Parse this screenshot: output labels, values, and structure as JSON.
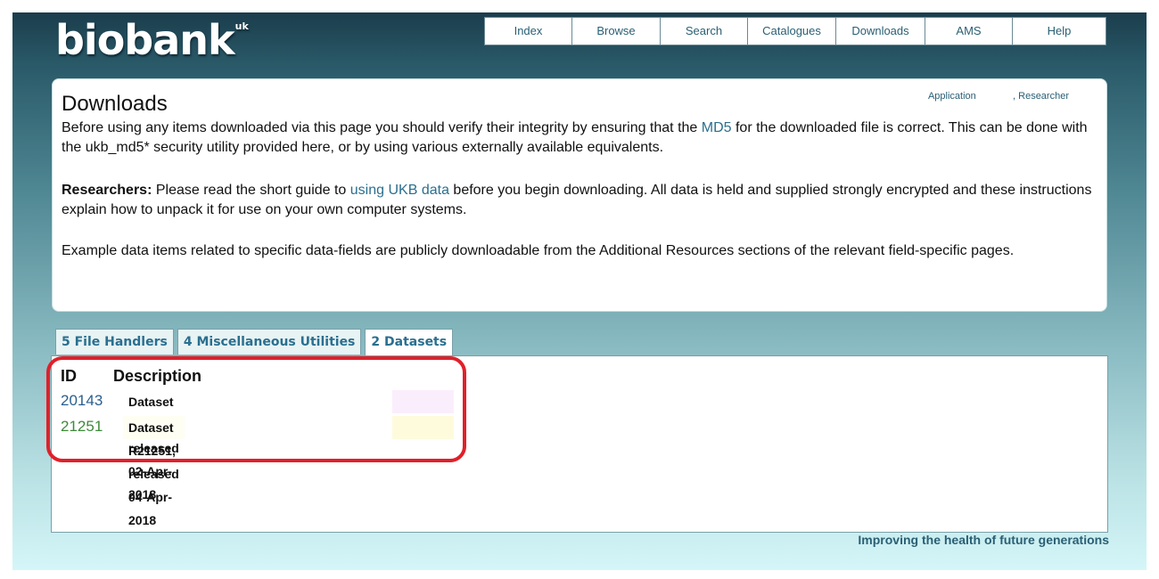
{
  "logo": {
    "text": "biobank",
    "superscript": "uk"
  },
  "nav": {
    "items": [
      {
        "label": "Index"
      },
      {
        "label": "Browse"
      },
      {
        "label": "Search"
      },
      {
        "label": "Catalogues"
      },
      {
        "label": "Downloads"
      },
      {
        "label": "AMS"
      },
      {
        "label": "Help"
      }
    ]
  },
  "panel": {
    "title": "Downloads",
    "toplinks": {
      "application": "Application",
      "researcher": ", Researcher"
    },
    "para1": {
      "pre": "Before using any items downloaded via this page you should verify their integrity by ensuring that the ",
      "link": "MD5",
      "post": " for the downloaded file is correct. This can be done with the ukb_md5* security utility provided here, or by using various externally available equivalents."
    },
    "para2": {
      "bold": "Researchers:",
      "pre": " Please read the short guide to ",
      "link": "using UKB data",
      "post": " before you begin downloading. All data is held and supplied strongly encrypted and these instructions explain how to unpack it for use on your own computer systems."
    },
    "para3": "Example data items related to specific data-fields are publicly downloadable from the Additional Resources sections of the relevant field-specific pages."
  },
  "tabs": [
    {
      "label": "5 File Handlers",
      "active": false
    },
    {
      "label": "4 Miscellaneous Utilities",
      "active": false
    },
    {
      "label": "2 Datasets",
      "active": true
    }
  ],
  "table": {
    "headers": {
      "id": "ID",
      "description": "Description"
    },
    "rows": [
      {
        "id": "20143",
        "description": "Dataset R20143, released 02-Apr-2018",
        "id_color": "#2a5f8f",
        "swatch_color": "#fbeefc"
      },
      {
        "id": "21251",
        "description": "Dataset R21251, released 04-Apr-2018",
        "id_color": "#3f8a3a",
        "swatch_color": "#fefbdd"
      }
    ]
  },
  "footer": "Improving the health of future generations",
  "colors": {
    "accent": "#2a5f74",
    "highlight": "#e0202a"
  }
}
